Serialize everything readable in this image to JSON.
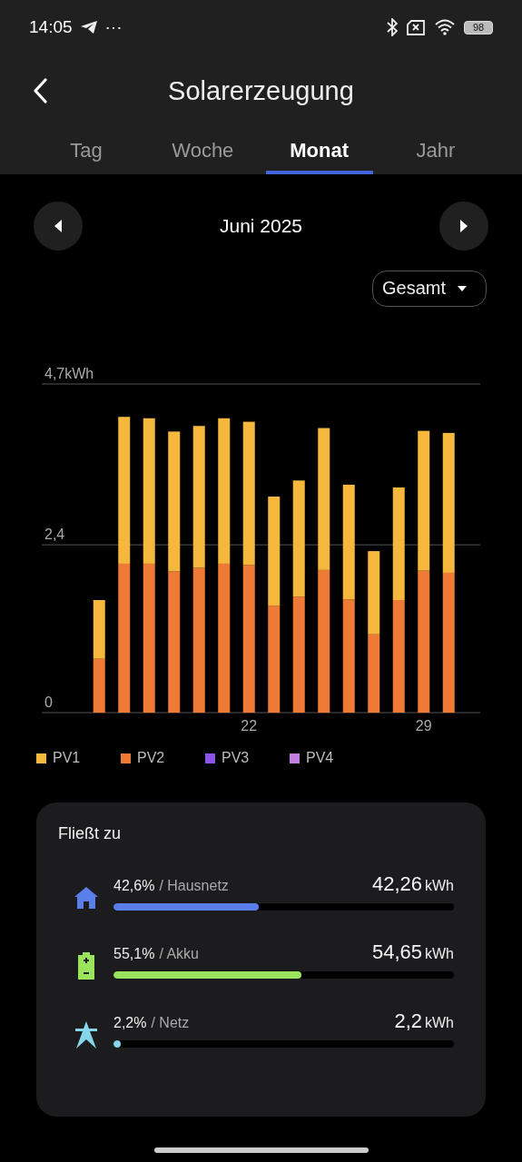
{
  "status_bar": {
    "time": "14:05",
    "more": "···",
    "battery": "98"
  },
  "header": {
    "title": "Solarerzeugung"
  },
  "tabs": [
    {
      "label": "Tag",
      "selected": false
    },
    {
      "label": "Woche",
      "selected": false
    },
    {
      "label": "Monat",
      "selected": true
    },
    {
      "label": "Jahr",
      "selected": false
    }
  ],
  "period": {
    "label": "Juni 2025"
  },
  "filter": {
    "value": "Gesamt"
  },
  "chart_data": {
    "type": "bar",
    "stacked": true,
    "x": [
      16,
      17,
      18,
      19,
      20,
      21,
      22,
      23,
      24,
      25,
      26,
      27,
      28,
      29,
      30
    ],
    "xlim": [
      13.7,
      31.3
    ],
    "xticks": [
      {
        "value": 22,
        "label": "22"
      },
      {
        "value": 29,
        "label": "29"
      }
    ],
    "ylim": [
      0,
      4.7
    ],
    "yticks": [
      {
        "value": 0,
        "label": "0"
      },
      {
        "value": 2.4,
        "label": "2,4"
      },
      {
        "value": 4.7,
        "label": "4,7kWh"
      }
    ],
    "series": [
      {
        "name": "PV1",
        "color": "#f5b83d",
        "values": [
          0.84,
          2.1,
          2.08,
          2.0,
          2.03,
          2.08,
          2.05,
          1.56,
          1.66,
          2.03,
          1.64,
          1.19,
          1.61,
          2.0,
          2.0
        ]
      },
      {
        "name": "PV2",
        "color": "#ef7a35",
        "values": [
          0.77,
          2.13,
          2.13,
          2.02,
          2.07,
          2.13,
          2.11,
          1.53,
          1.66,
          2.04,
          1.62,
          1.12,
          1.61,
          2.03,
          2.0
        ]
      },
      {
        "name": "PV3",
        "color": "#8a55e8",
        "values": [
          null,
          null,
          null,
          null,
          null,
          null,
          null,
          null,
          null,
          null,
          null,
          null,
          null,
          null,
          null
        ]
      },
      {
        "name": "PV4",
        "color": "#c27ee0",
        "values": [
          null,
          null,
          null,
          null,
          null,
          null,
          null,
          null,
          null,
          null,
          null,
          null,
          null,
          null,
          null
        ]
      }
    ]
  },
  "flow": {
    "title": "Fließt zu",
    "items": [
      {
        "kind": "home",
        "percent": "42,6%",
        "label": "/ Hausnetz",
        "value": "42,26",
        "unit": "kWh",
        "level": 0.426,
        "color": "#5b7fea"
      },
      {
        "kind": "battery",
        "percent": "55,1%",
        "label": "/ Akku",
        "value": "54,65",
        "unit": "kWh",
        "level": 0.551,
        "color": "#9ae35c"
      },
      {
        "kind": "grid",
        "percent": "2,2%",
        "label": "/ Netz",
        "value": "2,2",
        "unit": "kWh",
        "level": 0.022,
        "color": "#86d6ea"
      }
    ]
  }
}
